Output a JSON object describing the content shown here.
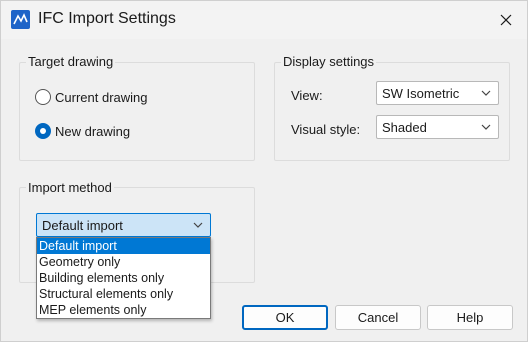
{
  "window": {
    "title": "IFC Import Settings",
    "app_icon": "autocad-app-icon",
    "close_icon": "close-icon"
  },
  "target_drawing": {
    "label": "Target drawing",
    "options": [
      {
        "label": "Current drawing",
        "checked": false
      },
      {
        "label": "New drawing",
        "checked": true
      }
    ]
  },
  "display_settings": {
    "label": "Display settings",
    "view_label": "View:",
    "view_value": "SW Isometric",
    "visual_style_label": "Visual style:",
    "visual_style_value": "Shaded"
  },
  "import_method": {
    "label": "Import method",
    "selected": "Default import",
    "options": [
      "Default import",
      "Geometry only",
      "Building elements only",
      "Structural elements only",
      "MEP elements only"
    ]
  },
  "buttons": {
    "ok": "OK",
    "cancel": "Cancel",
    "help": "Help"
  },
  "colors": {
    "accent": "#0067c0",
    "selection": "#0078d4",
    "focused_select": "#cce4f7",
    "background": "#f0f0f0"
  }
}
